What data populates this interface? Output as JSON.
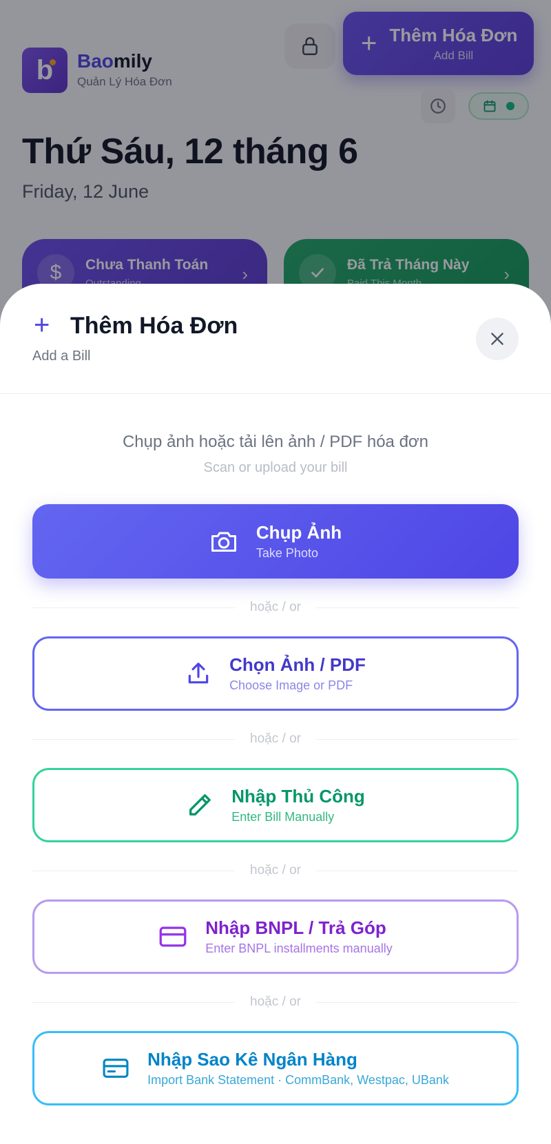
{
  "app": {
    "brand_part1": "Bao",
    "brand_part2": "mily",
    "brand_subtitle": "Quản Lý Hóa Đơn",
    "logo_letter": "b"
  },
  "header": {
    "add_bill_title": "Thêm Hóa Đơn",
    "add_bill_subtitle": "Add Bill"
  },
  "date": {
    "vn": "Thứ Sáu, 12 tháng 6",
    "en": "Friday, 12 June"
  },
  "stats": {
    "outstanding_title": "Chưa Thanh Toán",
    "outstanding_subtitle": "Outstanding",
    "paid_title": "Đã Trả Tháng Này",
    "paid_subtitle": "Paid This Month"
  },
  "sheet": {
    "title": "Thêm Hóa Đơn",
    "subtitle": "Add a Bill",
    "intro_vn": "Chụp ảnh hoặc tải lên ảnh / PDF hóa đơn",
    "intro_en": "Scan or upload your bill",
    "divider_text": "hoặc / or",
    "options": [
      {
        "title": "Chụp Ảnh",
        "subtitle": "Take Photo",
        "icon": "camera-icon"
      },
      {
        "title": "Chọn Ảnh / PDF",
        "subtitle": "Choose Image or PDF",
        "icon": "upload-icon"
      },
      {
        "title": "Nhập Thủ Công",
        "subtitle": "Enter Bill Manually",
        "icon": "pencil-icon"
      },
      {
        "title": "Nhập BNPL / Trả Góp",
        "subtitle": "Enter BNPL installments manually",
        "icon": "credit-card-icon"
      },
      {
        "title": "Nhập Sao Kê Ngân Hàng",
        "subtitle": "Import Bank Statement · CommBank, Westpac, UBank",
        "icon": "bank-card-icon"
      }
    ]
  },
  "colors": {
    "primary": "#4f46e5",
    "upload": "#6366f1",
    "manual": "#10b981",
    "bnpl": "#a78bfa",
    "bank": "#38bdf8",
    "paid_card": "#16a34a",
    "outstanding_card": "#5b3ed6"
  }
}
